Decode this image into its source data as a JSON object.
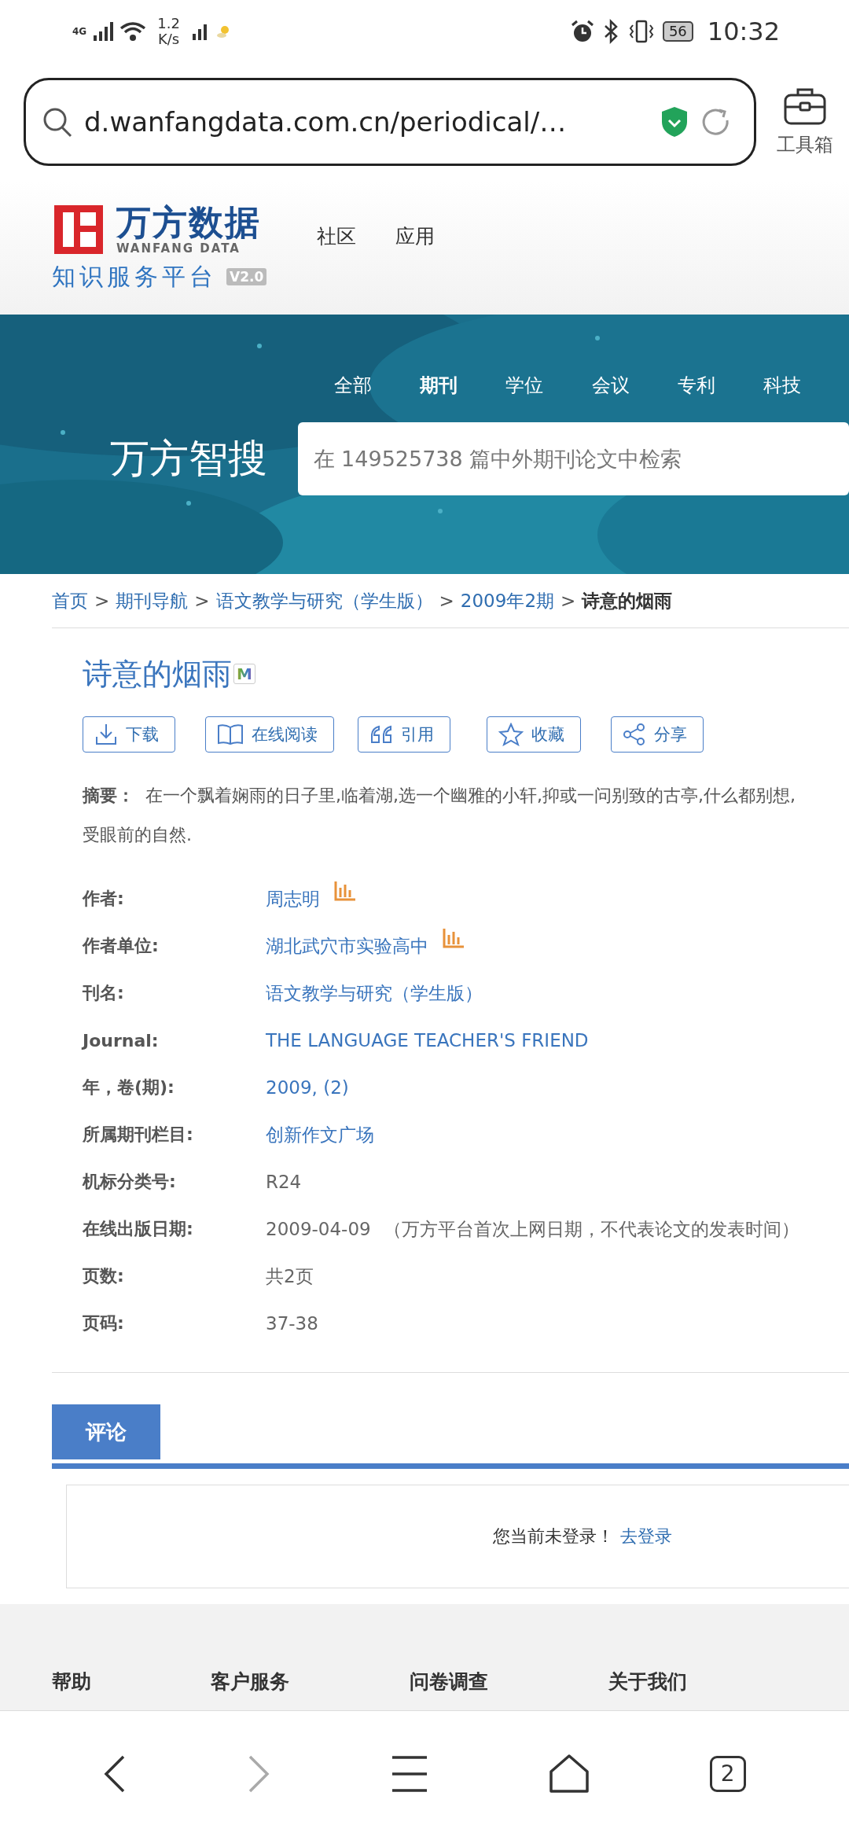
{
  "status_bar": {
    "network": "4G",
    "speed": "1.2",
    "speed_unit": "K/s",
    "battery": "56",
    "time": "10:32"
  },
  "address_bar": {
    "url": "d.wanfangdata.com.cn/periodical/…"
  },
  "toolbox": {
    "label": "工具箱"
  },
  "site_header": {
    "logo_name": "万方数据",
    "logo_subtitle": "WANFANG DATA",
    "logo_tagline": "知识服务平台",
    "version": "V2.0",
    "nav": [
      "社区",
      "应用"
    ]
  },
  "search": {
    "tabs": [
      {
        "label": "全部",
        "selected": false
      },
      {
        "label": "期刊",
        "selected": true
      },
      {
        "label": "学位",
        "selected": false
      },
      {
        "label": "会议",
        "selected": false
      },
      {
        "label": "专利",
        "selected": false
      },
      {
        "label": "科技",
        "selected": false
      }
    ],
    "brand": "万方智搜",
    "placeholder": "在 149525738 篇中外期刊论文中检索"
  },
  "breadcrumb": {
    "links": [
      "首页",
      "期刊导航",
      "语文教学与研究（学生版）",
      "2009年2期"
    ],
    "separator": ">",
    "current": "诗意的烟雨"
  },
  "article": {
    "title": "诗意的烟雨",
    "badge": "M",
    "actions": [
      {
        "label": "下载",
        "kind": "download"
      },
      {
        "label": "在线阅读",
        "kind": "read"
      },
      {
        "label": "引用",
        "kind": "cite"
      },
      {
        "label": "收藏",
        "kind": "favorite"
      },
      {
        "label": "分享",
        "kind": "share"
      }
    ],
    "abstract_label": "摘要：",
    "abstract_lines": [
      "在一个飘着娴雨的日子里,临着湖,选一个幽雅的小轩,抑或一问别致的古亭,什么都别想,",
      "受眼前的自然."
    ],
    "fields": [
      {
        "label": "作者:",
        "value": "周志明",
        "link": true,
        "stats": true
      },
      {
        "label": "作者单位:",
        "value": "湖北武穴市实验高中",
        "link": true,
        "stats": true
      },
      {
        "label": "刊名:",
        "value": "语文教学与研究（学生版）",
        "link": true,
        "stats": false
      },
      {
        "label": "Journal:",
        "value": "THE LANGUAGE TEACHER'S FRIEND",
        "link": true,
        "stats": false
      },
      {
        "label": "年，卷(期):",
        "value": "2009, (2)",
        "link": true,
        "stats": false
      },
      {
        "label": "所属期刊栏目:",
        "value": "创新作文广场",
        "link": true,
        "stats": false
      },
      {
        "label": "机标分类号:",
        "value": "R24",
        "link": false,
        "stats": false
      },
      {
        "label": "在线出版日期:",
        "value": "2009-04-09",
        "note": "（万方平台首次上网日期，不代表论文的发表时间）",
        "link": false,
        "stats": false
      },
      {
        "label": "页数:",
        "value": "共2页",
        "link": false,
        "stats": false
      },
      {
        "label": "页码:",
        "value": "37-38",
        "link": false,
        "stats": false
      }
    ]
  },
  "comments": {
    "tab": "评论",
    "notice": "您当前未登录！",
    "login_link": "去登录"
  },
  "footer": {
    "links": [
      "帮助",
      "客户服务",
      "问卷调查",
      "关于我们"
    ]
  },
  "browser_nav": {
    "tab_count": "2"
  }
}
